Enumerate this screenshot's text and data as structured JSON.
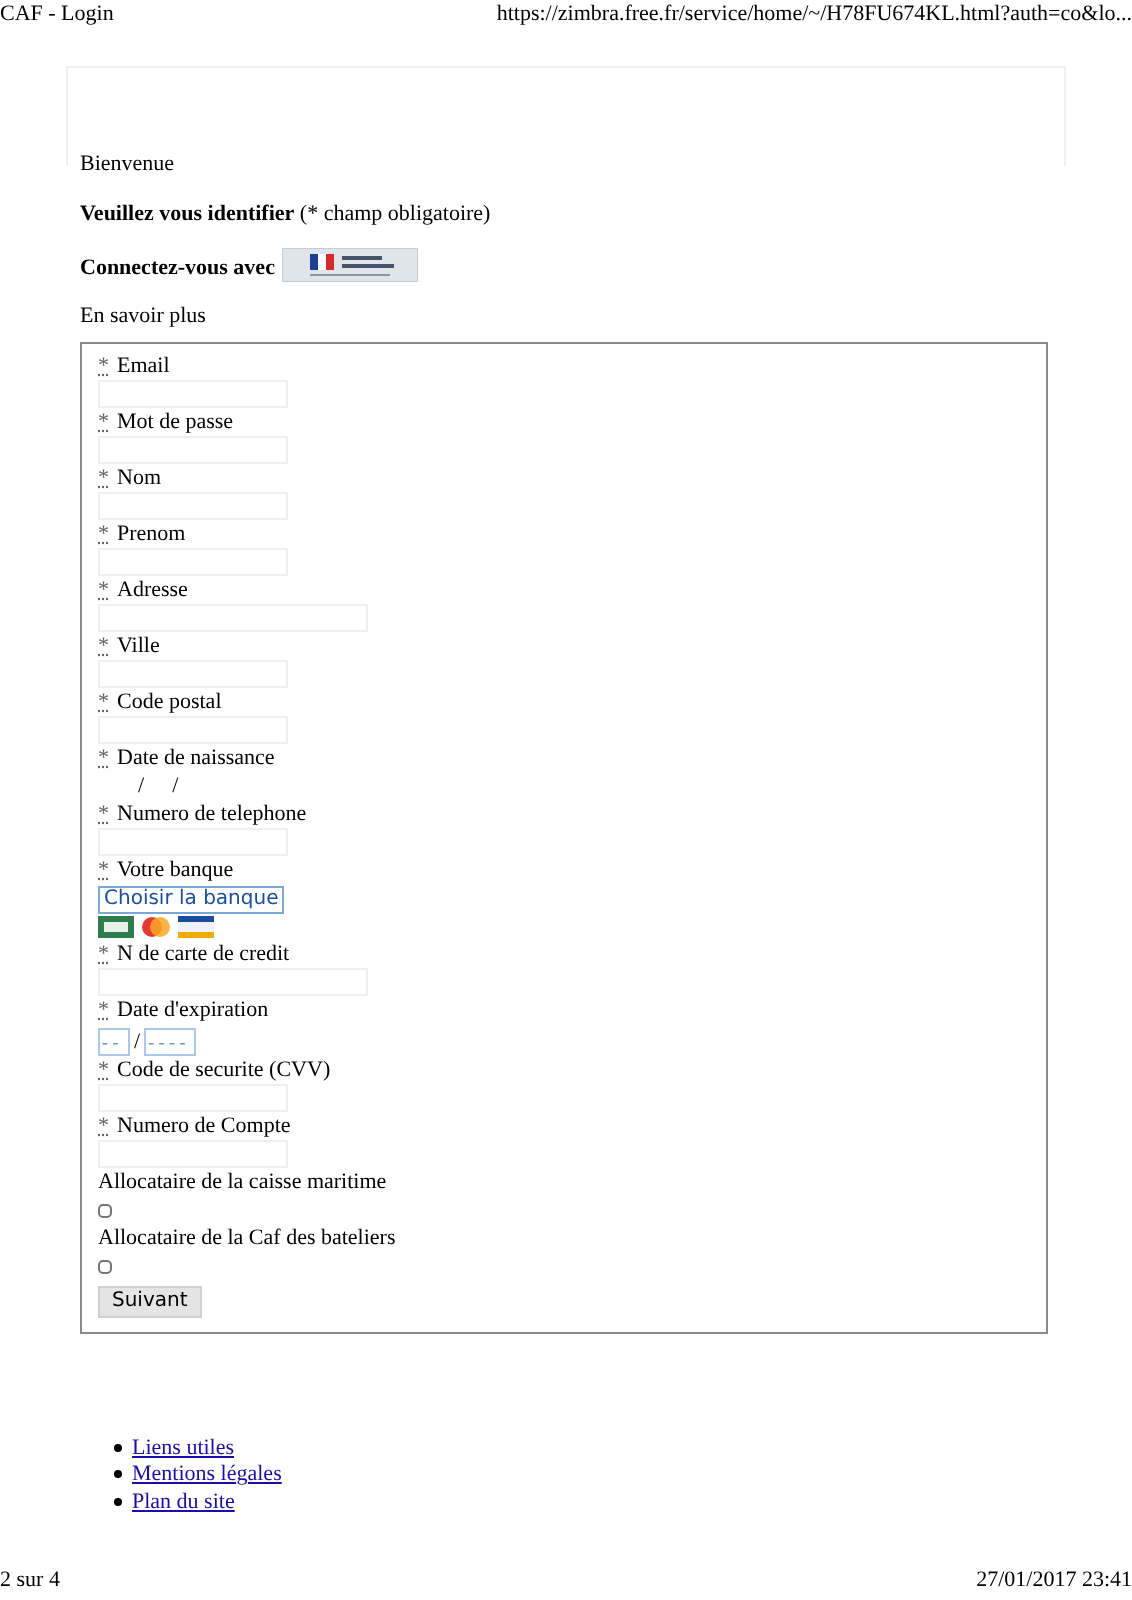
{
  "header": {
    "title": "CAF - Login",
    "url": "https://zimbra.free.fr/service/home/~/H78FU674KL.html?auth=co&lo..."
  },
  "intro": {
    "welcome": "Bienvenue",
    "prompt": "**Veuillez vous identifier** (* champ obligatoire)",
    "connect": "Connectez-vous avec",
    "more": "En savoir plus"
  },
  "fields": [
    {
      "kind": "text",
      "marker": "*",
      "label": "Email"
    },
    {
      "kind": "text",
      "marker": "*",
      "label": "Mot de passe"
    },
    {
      "kind": "text",
      "marker": "*",
      "label": "Nom"
    },
    {
      "kind": "text",
      "marker": "*",
      "label": "Prenom"
    },
    {
      "kind": "wide",
      "marker": "*",
      "label": "Adresse"
    },
    {
      "kind": "text",
      "marker": "*",
      "label": "Ville"
    },
    {
      "kind": "text",
      "marker": "*",
      "label": "Code postal"
    },
    {
      "kind": "date",
      "marker": "*",
      "label": "Date de naissance",
      "separators": [
        "/",
        "/"
      ]
    },
    {
      "kind": "text",
      "marker": "*",
      "label": "Numero de telephone"
    },
    {
      "kind": "select",
      "marker": "*",
      "label": "Votre banque",
      "value": "Choisir la banque"
    },
    {
      "kind": "wide",
      "marker": "*",
      "label": "N de carte de credit"
    },
    {
      "kind": "expiry",
      "marker": "*",
      "label": "Date d'expiration",
      "month": {
        "placeholder": "- -"
      },
      "separator": "/",
      "year": {
        "placeholder": "- - - -"
      }
    },
    {
      "kind": "text",
      "marker": "*",
      "label": "Code de securite (CVV)"
    },
    {
      "kind": "text",
      "marker": "*",
      "label": "Numero de Compte"
    },
    {
      "kind": "checkbox",
      "label": "Allocataire de la caisse maritime",
      "checked": false
    },
    {
      "kind": "checkbox",
      "label": "Allocataire de la Caf des bateliers",
      "checked": false
    }
  ],
  "submit": "Suivant",
  "links": [
    "Liens utiles",
    "Mentions légales",
    "Plan du site"
  ],
  "footer": {
    "page": "2 sur 4",
    "date": "27/01/2017 23:41"
  }
}
